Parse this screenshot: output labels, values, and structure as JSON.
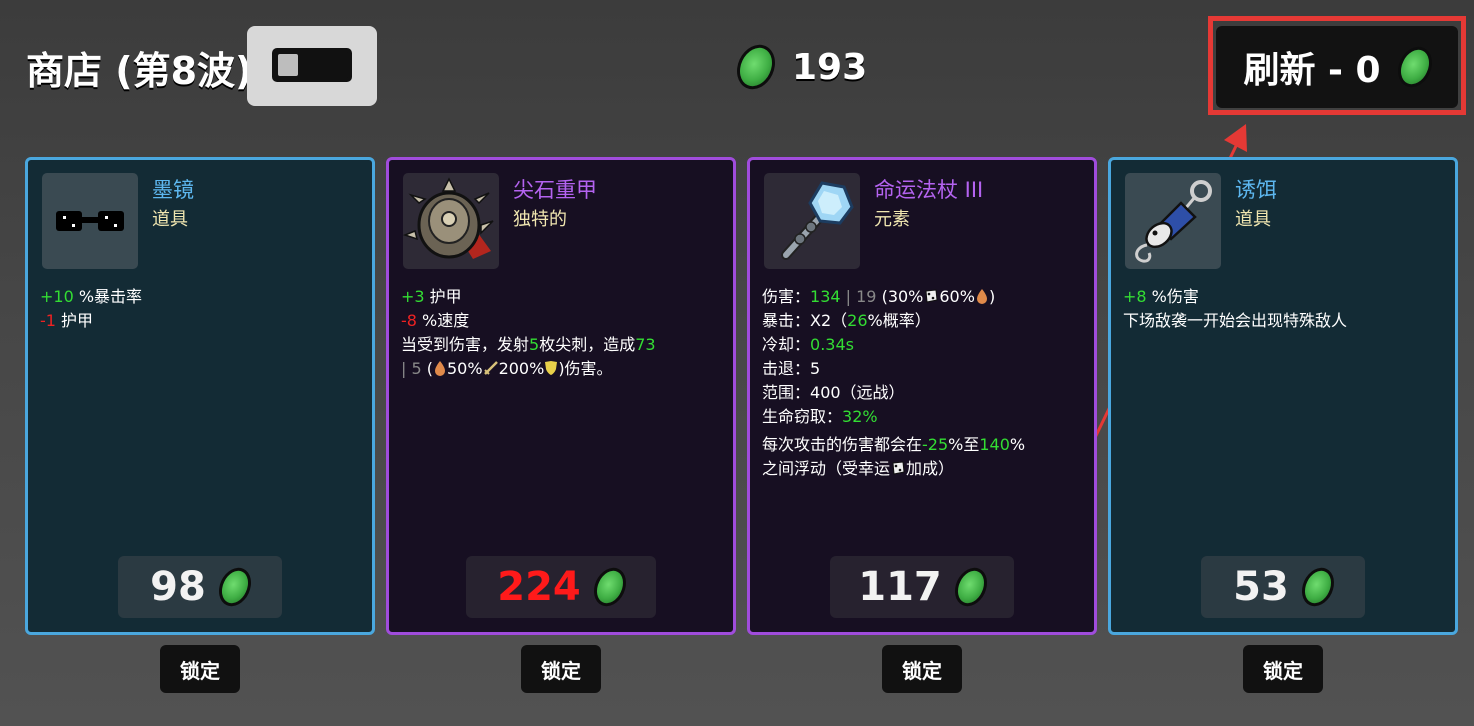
{
  "header": {
    "title": "商店 (第8波)",
    "currency_amount": "193",
    "refresh_label": "刷新 - 0"
  },
  "colors": {
    "common_border": "#4aa7de",
    "legendary_border": "#a04cdc",
    "positive": "#33dd33",
    "negative": "#ee2222",
    "highlight": "#e53935"
  },
  "cards": [
    {
      "name": "墨镜",
      "type": "道具",
      "icon": "sunglasses-icon",
      "stats": [
        {
          "value": "+10",
          "text": " %暴击率"
        },
        {
          "value": "-1",
          "text": " 护甲"
        }
      ],
      "price": "98",
      "lock_label": "锁定"
    },
    {
      "name": "尖石重甲",
      "type": "独特的",
      "icon": "spiked-armor-icon",
      "stats": [
        {
          "value": "+3",
          "text": " 护甲"
        },
        {
          "value": "-8",
          "text": " %速度"
        }
      ],
      "effect": {
        "pre": "当受到伤害，发射",
        "count": "5",
        "mid": "枚尖刺，造成",
        "damage": "73",
        "sep": " | ",
        "base": "5",
        "open": " (",
        "pct1": "50%",
        "pct2": "200%",
        "close": ")伤害。"
      },
      "price": "224",
      "lock_label": "锁定"
    },
    {
      "name": "命运法杖 III",
      "type": "元素",
      "icon": "crystal-staff-icon",
      "weapon_stats": {
        "damage_label": "伤害：",
        "damage": "134",
        "damage_sep": " | ",
        "damage_base": "19",
        "damage_scale_open": " (30%",
        "damage_scale_mid": "60%",
        "damage_scale_close": ")",
        "crit_label": "暴击：",
        "crit_mult": "X2",
        "crit_open": "（",
        "crit_chance": "26",
        "crit_close": "%概率）",
        "cooldown_label": "冷却：",
        "cooldown": "0.34s",
        "knockback_label": "击退：",
        "knockback": "5",
        "range_label": "范围：",
        "range": "400（远战）",
        "lifesteal_label": "生命窃取：",
        "lifesteal": "32%"
      },
      "effect": {
        "pre": "每次攻击的伤害都会在",
        "min": "-25",
        "mid": "%至",
        "max": "140",
        "post": "%",
        "line2_pre": "之间浮动（受幸运",
        "line2_post": "加成）"
      },
      "price": "117",
      "lock_label": "锁定"
    },
    {
      "name": "诱饵",
      "type": "道具",
      "icon": "bait-icon",
      "stats": [
        {
          "value": "+8",
          "text": " %伤害"
        }
      ],
      "description": "下场敌袭一开始会出现特殊敌人",
      "price": "53",
      "lock_label": "锁定"
    }
  ]
}
